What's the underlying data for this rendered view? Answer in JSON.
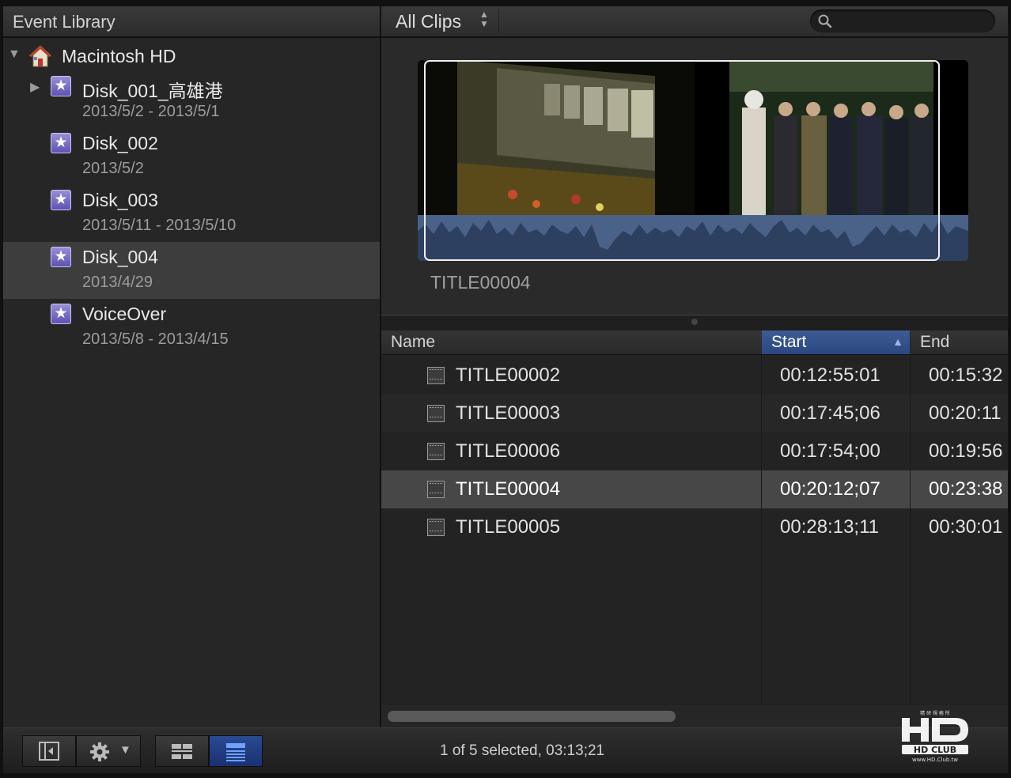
{
  "library": {
    "title": "Event Library",
    "volume": "Macintosh HD",
    "events": [
      {
        "name": "Disk_001_高雄港",
        "dates": "2013/5/2 - 2013/5/1"
      },
      {
        "name": "Disk_002",
        "dates": "2013/5/2"
      },
      {
        "name": "Disk_003",
        "dates": "2013/5/11 - 2013/5/10"
      },
      {
        "name": "Disk_004",
        "dates": "2013/4/29"
      },
      {
        "name": "VoiceOver",
        "dates": "2013/5/8 - 2013/4/15"
      }
    ]
  },
  "browser": {
    "filter": "All Clips",
    "search_placeholder": "",
    "preview_title": "TITLE00004",
    "columns": {
      "name": "Name",
      "start": "Start",
      "end": "End"
    },
    "clips": [
      {
        "name": "TITLE00002",
        "start": "00:12:55:01",
        "end": "00:15:32"
      },
      {
        "name": "TITLE00003",
        "start": "00:17:45;06",
        "end": "00:20:11"
      },
      {
        "name": "TITLE00006",
        "start": "00:17:54;00",
        "end": "00:19:56"
      },
      {
        "name": "TITLE00004",
        "start": "00:20:12;07",
        "end": "00:23:38"
      },
      {
        "name": "TITLE00005",
        "start": "00:28:13;11",
        "end": "00:30:01"
      }
    ]
  },
  "status": "1 of 5 selected, 03:13;21",
  "logo": {
    "text": "HD CLUB",
    "url_text": "www.HD.Club.tw"
  },
  "colors": {
    "accent": "#2b4780",
    "event_icon": "#6f64c4",
    "waveform": "#4a6288"
  }
}
